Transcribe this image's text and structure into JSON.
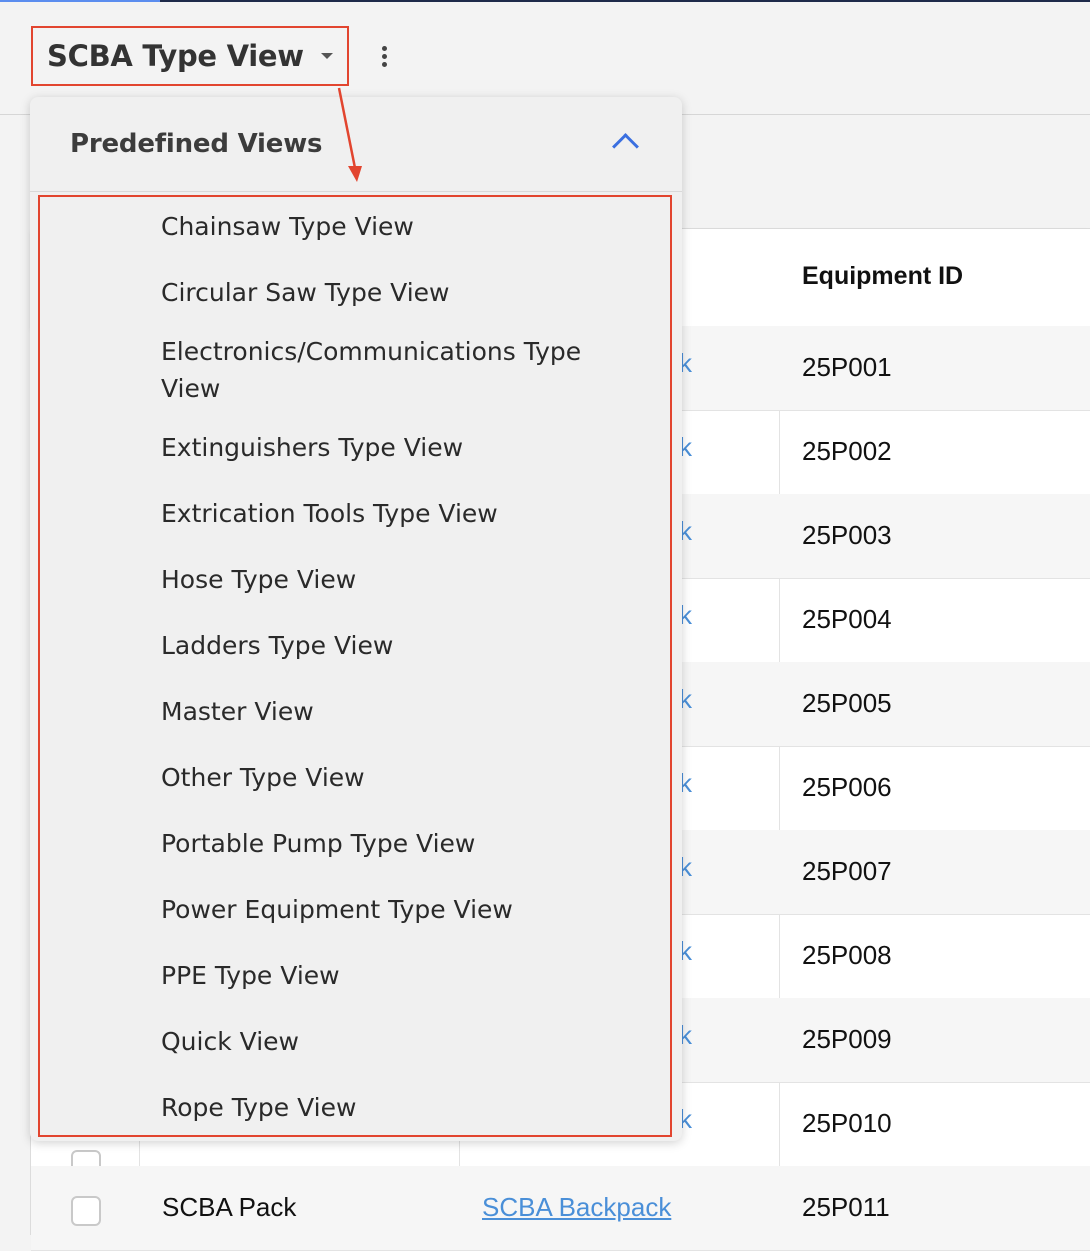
{
  "view_selector": {
    "title": "SCBA Type View"
  },
  "dropdown": {
    "header": "Predefined Views",
    "items": [
      "Chainsaw Type View",
      "Circular Saw Type View",
      "Electronics/Communications Type View",
      "Extinguishers Type View",
      "Extrication Tools Type View",
      "Hose Type View",
      "Ladders Type View",
      "Master View",
      "Other Type View",
      "Portable Pump Type View",
      "Power Equipment Type View",
      "PPE Type View",
      "Quick View",
      "Rope Type View"
    ]
  },
  "table": {
    "columns": {
      "equipment_id": "Equipment ID"
    },
    "rows": [
      {
        "equipment_id": "25P001"
      },
      {
        "equipment_id": "25P002"
      },
      {
        "equipment_id": "25P003"
      },
      {
        "equipment_id": "25P004"
      },
      {
        "equipment_id": "25P005"
      },
      {
        "equipment_id": "25P006"
      },
      {
        "equipment_id": "25P007"
      },
      {
        "equipment_id": "25P008"
      },
      {
        "equipment_id": "25P009"
      },
      {
        "equipment_id": "25P010"
      },
      {
        "equipment_id": "25P011",
        "type": "SCBA Pack",
        "link": "SCBA Backpack"
      }
    ],
    "link_fragment": "k"
  },
  "colors": {
    "highlight": "#e2452f",
    "link": "#4a8fd8",
    "chevron": "#3a6fe0"
  }
}
